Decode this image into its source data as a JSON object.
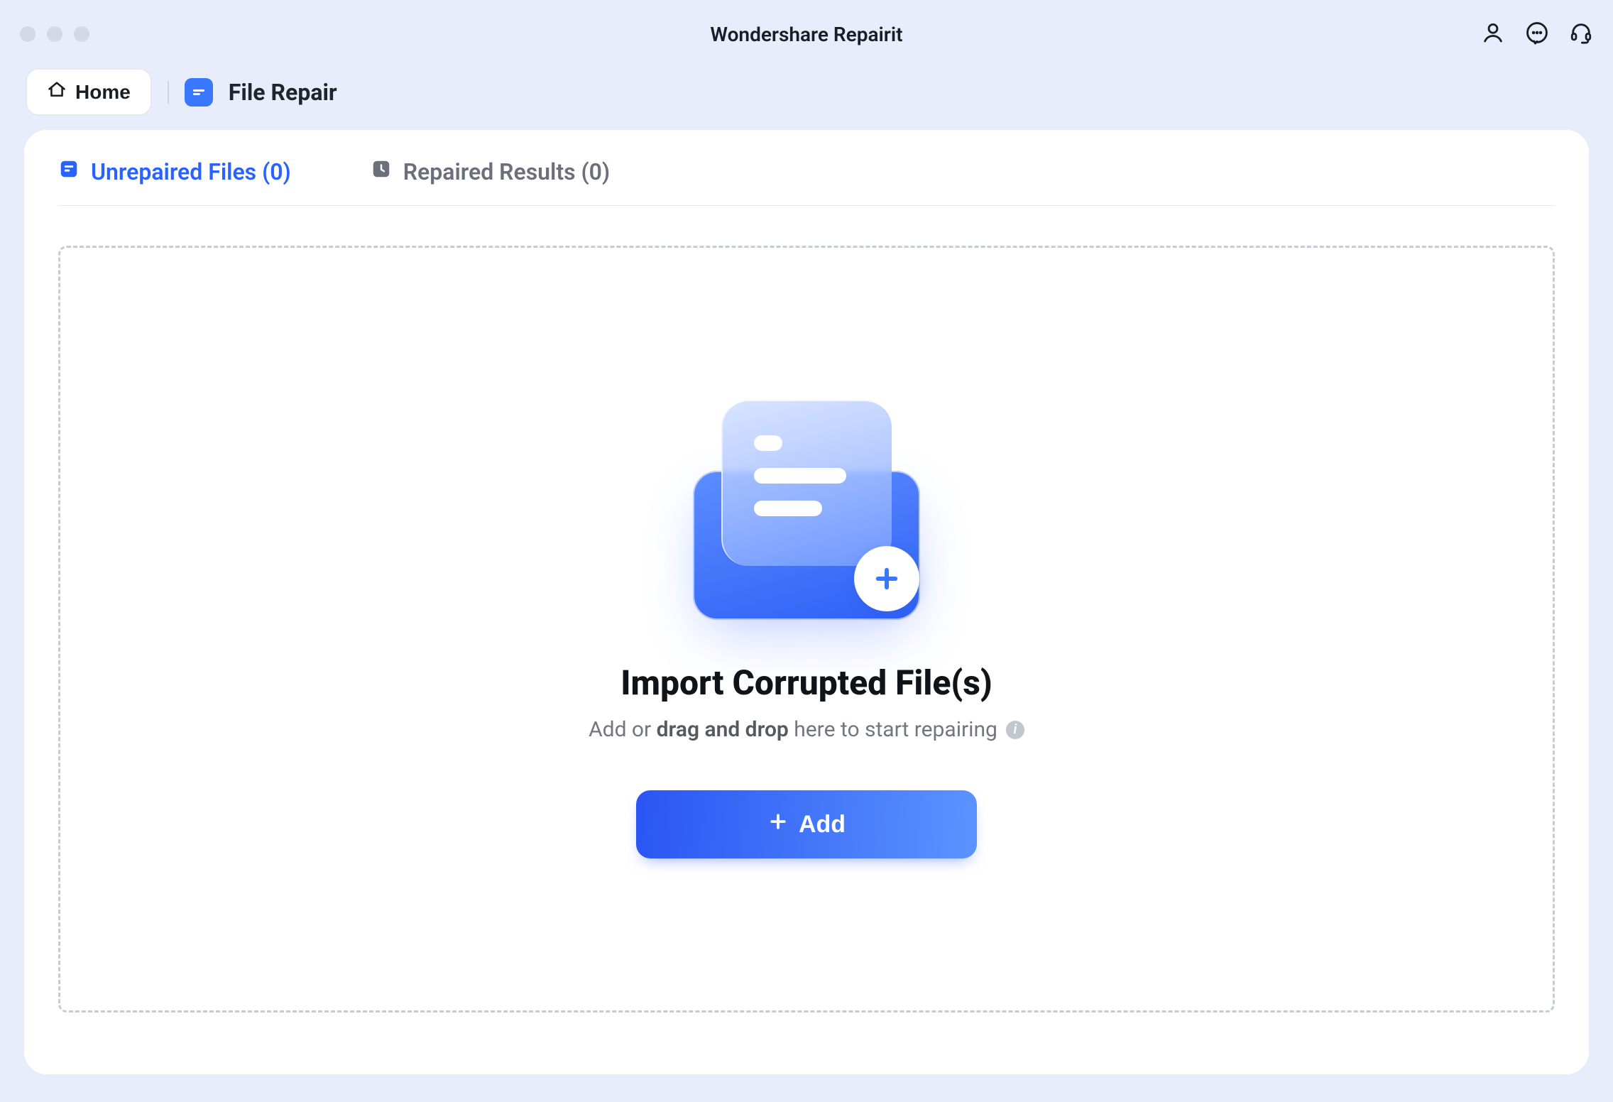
{
  "app_title": "Wondershare Repairit",
  "nav": {
    "home_label": "Home",
    "page_title": "File Repair"
  },
  "tabs": {
    "unrepaired": {
      "label": "Unrepaired Files",
      "count": 0
    },
    "repaired": {
      "label": "Repaired Results",
      "count": 0
    }
  },
  "drop": {
    "heading": "Import Corrupted File(s)",
    "sub_prefix": "Add or ",
    "sub_bold": "drag and drop",
    "sub_suffix": " here to start repairing",
    "add_button": "Add"
  }
}
